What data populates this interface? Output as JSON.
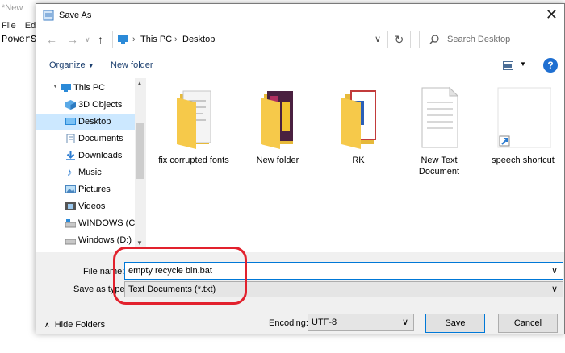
{
  "background_app": {
    "title": "*New",
    "menu": [
      "File",
      "Edit"
    ],
    "text": "PowerS"
  },
  "dialog": {
    "title": "Save As",
    "breadcrumb": [
      "This PC",
      "Desktop"
    ],
    "search_placeholder": "Search Desktop",
    "toolbar": {
      "organize": "Organize",
      "new_folder": "New folder"
    },
    "help_label": "?"
  },
  "nav_items": [
    {
      "label": "This PC",
      "icon": "pc-icon"
    },
    {
      "label": "3D Objects",
      "icon": "cube-icon"
    },
    {
      "label": "Desktop",
      "icon": "desktop-icon",
      "selected": true
    },
    {
      "label": "Documents",
      "icon": "documents-icon"
    },
    {
      "label": "Downloads",
      "icon": "download-icon"
    },
    {
      "label": "Music",
      "icon": "music-icon"
    },
    {
      "label": "Pictures",
      "icon": "pictures-icon"
    },
    {
      "label": "Videos",
      "icon": "videos-icon"
    },
    {
      "label": "WINDOWS (C:)",
      "icon": "drive-icon"
    },
    {
      "label": "Windows (D:)",
      "icon": "drive-icon"
    }
  ],
  "files": [
    {
      "label": "fix corrupted fonts",
      "type": "folder"
    },
    {
      "label": "New folder",
      "type": "folder"
    },
    {
      "label": "RK",
      "type": "folder"
    },
    {
      "label": "New Text Document",
      "type": "text-document"
    },
    {
      "label": "speech shortcut",
      "type": "shortcut"
    }
  ],
  "form": {
    "file_name_label": "File name:",
    "file_name_value": "empty recycle bin.bat",
    "save_as_type_label": "Save as type:",
    "save_as_type_value": "Text Documents (*.txt)",
    "encoding_label": "Encoding:",
    "encoding_value": "UTF-8",
    "hide_folders": "Hide Folders",
    "save": "Save",
    "cancel": "Cancel"
  },
  "colors": {
    "accent": "#0078d7",
    "selection": "#cce8ff",
    "annotation": "#e2212d",
    "folder": "#f6c94a"
  }
}
